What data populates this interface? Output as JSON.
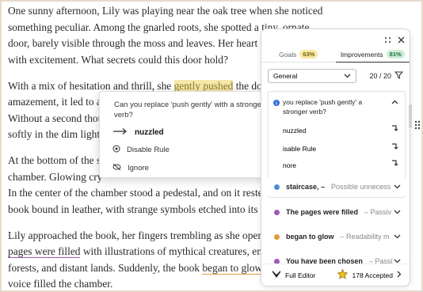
{
  "document": {
    "paragraphs": [
      [
        "One sunny afternoon, Lily was playing near the oak tree when she noticed",
        "something peculiar. Among the gnarled roots, she spotted a tiny, ornate",
        "door, barely visible through the moss and leaves. Her heart sk",
        "with excitement. What secrets could this door hold?"
      ],
      [
        "amazement, it led to a",
        "Without a second thou",
        "softly in the dim light."
      ],
      [
        "At the bottom of the st",
        "chamber. Glowing cry",
        "In the center of the chamber stood a pedestal, and on it restec",
        "book bound in leather, with strange symbols etched into its co"
      ],
      [
        "Lily approached the book, her fingers trembling as she opene",
        "with illustrations of mythical creatures, enc",
        "forests, and distant lands. Suddenly, the book",
        ", a",
        "voice filled the chamber."
      ]
    ],
    "p2_prefix": "With a mix of hesitation and thrill, she ",
    "p2_highlight": "gently pushed",
    "p2_suffix": " the doo",
    "p4_underline": "pages were filled",
    "p4_underline2": "began to glow"
  },
  "popup": {
    "question": "Can you replace 'push gently' with a stronger verb?",
    "suggestion": "nuzzled",
    "disable": "Disable Rule",
    "ignore": "Ignore"
  },
  "panel": {
    "tabs": [
      {
        "label": "Goals",
        "badge": "63%"
      },
      {
        "label": "Improvements",
        "badge": "81%"
      }
    ],
    "filter": "General",
    "count": "20 / 20",
    "card": {
      "question": "you replace 'push gently' a stronger verb?",
      "opt1": "nuzzled",
      "opt2": "isable Rule",
      "opt3": "nore"
    },
    "rows": [
      {
        "bold": "staircase, –",
        "muted": "Possible unnecess",
        "color": "#4a90d9"
      },
      {
        "bold": "The pages were filled",
        "muted": "– Passiv",
        "color": "#9b59b6"
      },
      {
        "bold": "began to glow",
        "muted": "– Readability m",
        "color": "#e39a3a"
      },
      {
        "bold": "You have been chosen",
        "muted": "– Passi",
        "color": "#9b59b6"
      }
    ],
    "footer_left": "Full Editor",
    "footer_right": "178 Accepted"
  },
  "colors": {
    "accent_blue": "#2f6fd6",
    "purple": "#9b59b6",
    "orange": "#e39a3a",
    "yellow": "#e0c15a"
  }
}
